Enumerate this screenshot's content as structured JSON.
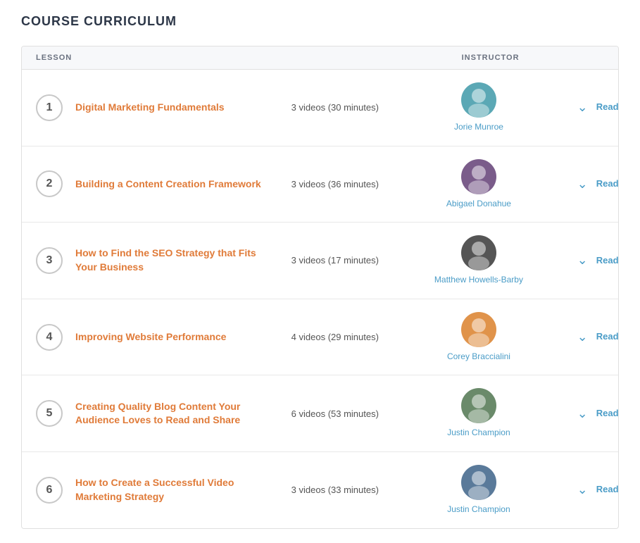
{
  "page": {
    "title": "COURSE CURRICULUM"
  },
  "table": {
    "headers": {
      "lesson": "LESSON",
      "instructor": "INSTRUCTOR"
    },
    "rows": [
      {
        "number": "1",
        "title": "Digital Marketing Fundamentals",
        "meta": "3 videos (30 minutes)",
        "instructor_name": "Jorie Munroe",
        "avatar_emoji": "👩",
        "avatar_class": "avatar-1",
        "read_more": "Read more",
        "chevron": "⌄"
      },
      {
        "number": "2",
        "title": "Building a Content Creation Framework",
        "meta": "3 videos (36 minutes)",
        "instructor_name": "Abigael Donahue",
        "avatar_emoji": "👨",
        "avatar_class": "avatar-2",
        "read_more": "Read more",
        "chevron": "⌄"
      },
      {
        "number": "3",
        "title": "How to Find the SEO Strategy that Fits Your Business",
        "meta": "3 videos (17 minutes)",
        "instructor_name": "Matthew Howells-Barby",
        "avatar_emoji": "👨",
        "avatar_class": "avatar-3",
        "read_more": "Read more",
        "chevron": "⌄"
      },
      {
        "number": "4",
        "title": "Improving Website Performance",
        "meta": "4 videos (29 minutes)",
        "instructor_name": "Corey Braccialini",
        "avatar_emoji": "👨",
        "avatar_class": "avatar-4",
        "read_more": "Read more",
        "chevron": "⌄"
      },
      {
        "number": "5",
        "title": "Creating Quality Blog Content Your Audience Loves to Read and Share",
        "meta": "6 videos (53 minutes)",
        "instructor_name": "Justin Champion",
        "avatar_emoji": "👨",
        "avatar_class": "avatar-5",
        "read_more": "Read more",
        "chevron": "⌄"
      },
      {
        "number": "6",
        "title": "How to Create a Successful Video Marketing Strategy",
        "meta": "3 videos (33 minutes)",
        "instructor_name": "Justin Champion",
        "avatar_emoji": "👨",
        "avatar_class": "avatar-6",
        "read_more": "Read more",
        "chevron": "⌄"
      }
    ]
  }
}
